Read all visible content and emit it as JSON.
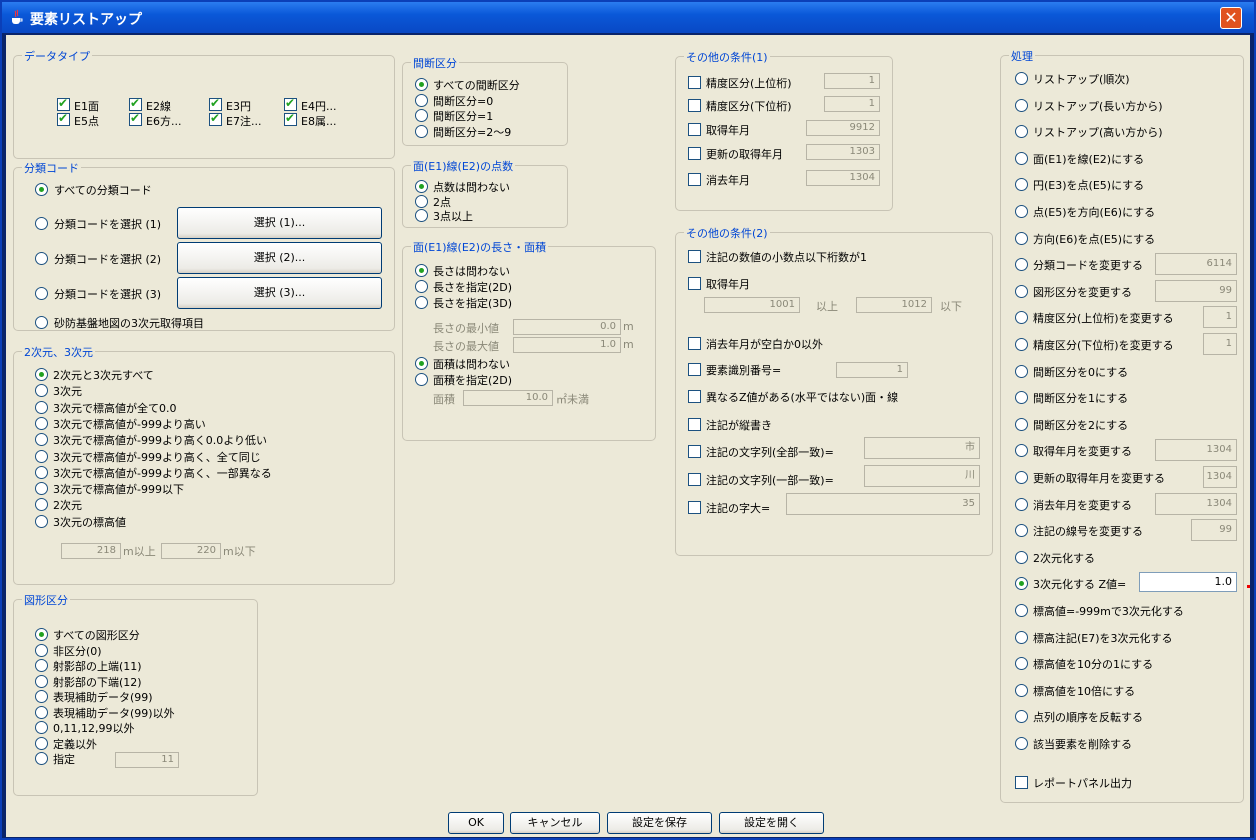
{
  "window": {
    "title": "要素リストアップ",
    "close_icon": "close-icon",
    "title_icon": "java-cup-icon"
  },
  "datatype": {
    "legend": "データタイプ",
    "items": [
      {
        "label": "E1面",
        "checked": true
      },
      {
        "label": "E2線",
        "checked": true
      },
      {
        "label": "E3円",
        "checked": true
      },
      {
        "label": "E4円...",
        "checked": true
      },
      {
        "label": "E5点",
        "checked": true
      },
      {
        "label": "E6方...",
        "checked": true
      },
      {
        "label": "E7注...",
        "checked": true
      },
      {
        "label": "E8属...",
        "checked": true
      }
    ]
  },
  "bunrui": {
    "legend": "分類コード",
    "all": "すべての分類コード",
    "sel1": "分類コードを選択 (1)",
    "btn1": "選択 (1)...",
    "sel2": "分類コードを選択 (2)",
    "btn2": "選択 (2)...",
    "sel3": "分類コードを選択 (3)",
    "btn3": "選択 (3)...",
    "sabo": "砂防基盤地図の3次元取得項目"
  },
  "dim": {
    "legend": "2次元、3次元",
    "items": [
      "2次元と3次元すべて",
      "3次元",
      "3次元で標高値が全て0.0",
      "3次元で標高値が-999より高い",
      "3次元で標高値が-999より高く0.0より低い",
      "3次元で標高値が-999より高く、全て同じ",
      "3次元で標高値が-999より高く、一部異なる",
      "3次元で標高値が-999以下",
      "2次元",
      "3次元の標高値"
    ],
    "low_value": "218",
    "low_unit": "m以上",
    "high_value": "220",
    "high_unit": "m以下"
  },
  "zukei": {
    "legend": "図形区分",
    "items": [
      "すべての図形区分",
      "非区分(0)",
      "射影部の上端(11)",
      "射影部の下端(12)",
      "表現補助データ(99)",
      "表現補助データ(99)以外",
      "0,11,12,99以外",
      "定義以外",
      "指定"
    ],
    "shitei_value": "11"
  },
  "kandan": {
    "legend": "間断区分",
    "items": [
      "すべての間断区分",
      "間断区分=0",
      "間断区分=1",
      "間断区分=2〜9"
    ]
  },
  "tensu": {
    "legend": "面(E1)線(E2)の点数",
    "items": [
      "点数は問わない",
      "2点",
      "3点以上"
    ]
  },
  "nagasa": {
    "legend": "面(E1)線(E2)の長さ・面積",
    "items": [
      "長さは問わない",
      "長さを指定(2D)",
      "長さを指定(3D)"
    ],
    "min_label": "長さの最小値",
    "min_value": "0.0",
    "max_label": "長さの最大値",
    "max_value": "1.0",
    "unit_m": "m",
    "area_items": [
      "面積は問わない",
      "面積を指定(2D)"
    ],
    "area_label": "面積",
    "area_value": "10.0",
    "area_unit": "㎡未満"
  },
  "other1": {
    "legend": "その他の条件(1)",
    "items": [
      {
        "label": "精度区分(上位桁)",
        "value": "1"
      },
      {
        "label": "精度区分(下位桁)",
        "value": "1"
      },
      {
        "label": "取得年月",
        "value": "9912"
      },
      {
        "label": "更新の取得年月",
        "value": "1303"
      },
      {
        "label": "消去年月",
        "value": "1304"
      }
    ]
  },
  "other2": {
    "legend": "その他の条件(2)",
    "c1": "注記の数値の小数点以下桁数が1",
    "c2": "取得年月",
    "y_from": "1001",
    "y_from_unit": "以上",
    "y_to": "1012",
    "y_to_unit": "以下",
    "c3": "消去年月が空白か0以外",
    "c4": "要素識別番号=",
    "c4_value": "1",
    "c5": "異なるZ値がある(水平ではない)面・線",
    "c6": "注記が縦書き",
    "c7": "注記の文字列(全部一致)=",
    "c7_value": "市",
    "c8": "注記の文字列(一部一致)=",
    "c8_value": "川",
    "c9": "注記の字大=",
    "c9_value": "35"
  },
  "shori": {
    "legend": "処理",
    "items": [
      {
        "label": "リストアップ(順次)"
      },
      {
        "label": "リストアップ(長い方から)"
      },
      {
        "label": "リストアップ(高い方から)"
      },
      {
        "label": "面(E1)を線(E2)にする"
      },
      {
        "label": "円(E3)を点(E5)にする"
      },
      {
        "label": "点(E5)を方向(E6)にする"
      },
      {
        "label": "方向(E6)を点(E5)にする"
      },
      {
        "label": "分類コードを変更する",
        "value": "6114"
      },
      {
        "label": "図形区分を変更する",
        "value": "99"
      },
      {
        "label": "精度区分(上位桁)を変更する",
        "value": "1"
      },
      {
        "label": "精度区分(下位桁)を変更する",
        "value": "1"
      },
      {
        "label": "間断区分を0にする"
      },
      {
        "label": "間断区分を1にする"
      },
      {
        "label": "間断区分を2にする"
      },
      {
        "label": "取得年月を変更する",
        "value": "1304"
      },
      {
        "label": "更新の取得年月を変更する",
        "value": "1304"
      },
      {
        "label": "消去年月を変更する",
        "value": "1304"
      },
      {
        "label": "注記の線号を変更する",
        "value": "99"
      },
      {
        "label": "2次元化する"
      },
      {
        "label": "3次元化する Z値=",
        "value": "1.0"
      },
      {
        "label": "標高値=-999mで3次元化する"
      },
      {
        "label": "標高注記(E7)を3次元化する"
      },
      {
        "label": "標高値を10分の1にする"
      },
      {
        "label": "標高値を10倍にする"
      },
      {
        "label": "点列の順序を反転する"
      },
      {
        "label": "該当要素を削除する"
      }
    ],
    "report": "レポートパネル出力"
  },
  "buttons": {
    "ok": "OK",
    "cancel": "キャンセル",
    "save": "設定を保存",
    "open": "設定を開く"
  }
}
